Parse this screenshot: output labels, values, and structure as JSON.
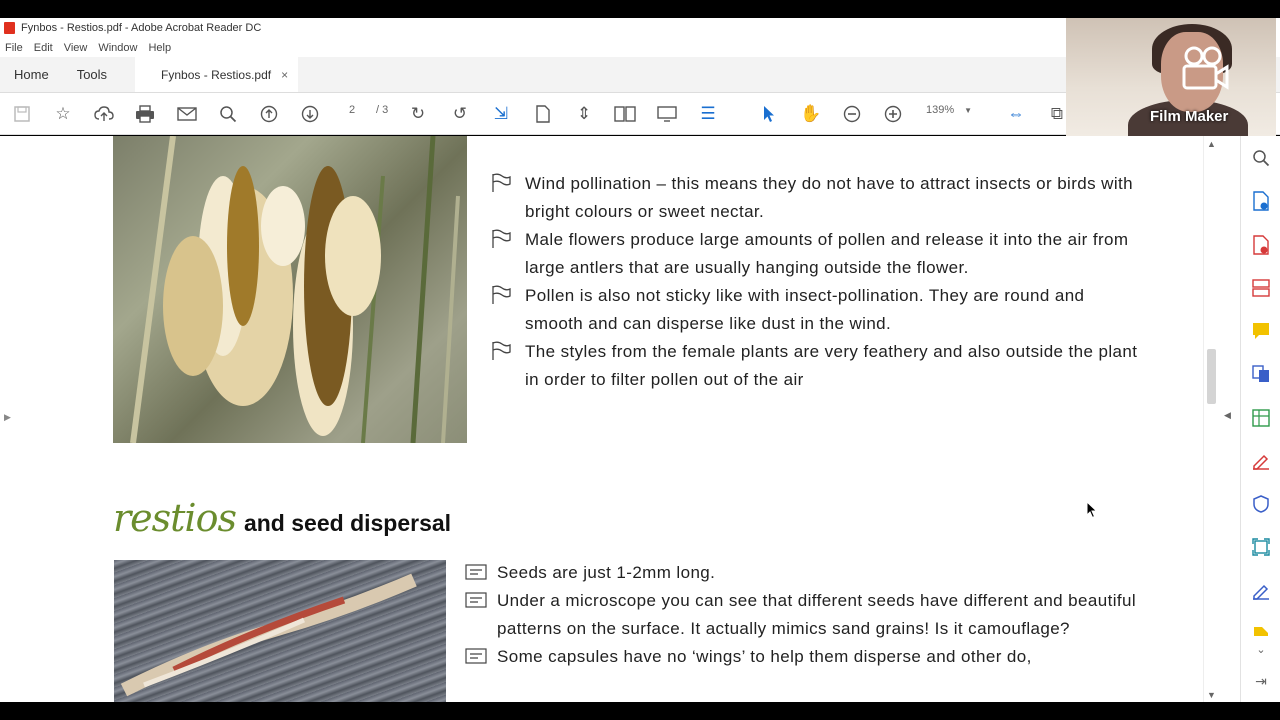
{
  "window": {
    "title": "Fynbos - Restios.pdf - Adobe Acrobat Reader DC"
  },
  "menu": [
    "File",
    "Edit",
    "View",
    "Window",
    "Help"
  ],
  "tabs": {
    "home": "Home",
    "tools": "Tools",
    "document": "Fynbos - Restios.pdf",
    "close": "×"
  },
  "toolbar": {
    "current_page": "2",
    "total_pages": "/ 3",
    "zoom": "139%"
  },
  "webcam": {
    "label": "Film Maker"
  },
  "section1": {
    "bullets": [
      "Wind pollination – this means they do not have to attract insects or birds with bright colours or sweet nectar.",
      "Male flowers produce large amounts of pollen and release it into the air from large antlers that are usually hanging outside the flower.",
      "Pollen is also not sticky like with insect-pollination. They are round and smooth and can disperse like dust in the wind.",
      "The styles from the female plants are very feathery and also outside the plant in order to filter pollen out of the air"
    ]
  },
  "section2": {
    "heading_script": "restios",
    "heading_rest": "and seed dispersal",
    "bullets": [
      "Seeds are just 1-2mm long.",
      "Under a microscope you can see that different seeds have different and beautiful patterns on the surface. It actually mimics sand grains! Is it camouflage?",
      "Some capsules have no ‘wings’ to help them disperse and other do,"
    ]
  },
  "colors": {
    "accent_blue": "#1a6fd0",
    "heading_green": "#6b8d2e",
    "adobe_red": "#e0301e"
  }
}
